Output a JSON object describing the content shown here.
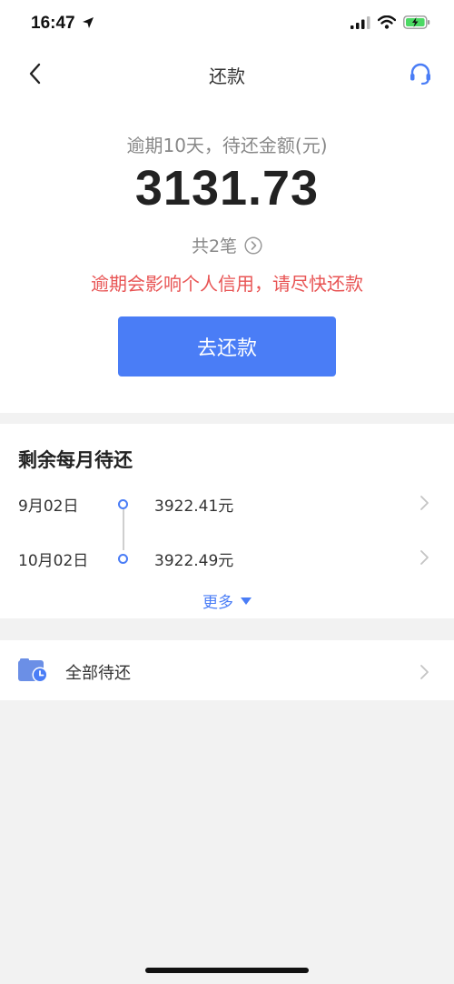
{
  "status_bar": {
    "time": "16:47",
    "icons": [
      "location-arrow-icon",
      "cellular-signal-icon",
      "wifi-icon",
      "battery-charging-icon"
    ]
  },
  "nav": {
    "title": "还款",
    "back_icon": "chevron-left-icon",
    "service_icon": "headset-icon"
  },
  "summary": {
    "label": "逾期10天，待还金额(元)",
    "amount": "3131.73",
    "count_label": "共2笔",
    "warning": "逾期会影响个人信用，请尽快还款",
    "pay_button": "去还款"
  },
  "monthly": {
    "title": "剩余每月待还",
    "rows": [
      {
        "date": "9月02日",
        "amount": "3922.41元"
      },
      {
        "date": "10月02日",
        "amount": "3922.49元"
      }
    ],
    "more_label": "更多"
  },
  "all_pending": {
    "label": "全部待还",
    "icon": "calendar-clock-icon"
  },
  "colors": {
    "accent": "#4a7df6",
    "warning": "#e85454",
    "background": "#f2f2f2",
    "battery": "#4cd964"
  }
}
